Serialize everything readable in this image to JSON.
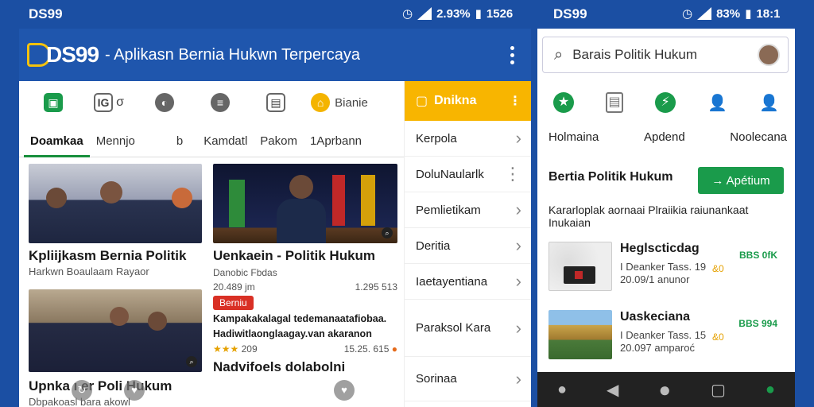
{
  "status": {
    "left_brand": "DS99",
    "right_brand": "DS99",
    "left_indicators": "2.93%",
    "left_time": "1526",
    "right_indicators": "83%",
    "right_time": "18:1"
  },
  "appbar": {
    "logo": "DS99",
    "title": "- Aplikasn Bernia Hukwn Terpercaya"
  },
  "iconrow": {
    "items": [
      {
        "icon": "briefcase-icon",
        "color": "#1a9b4b",
        "label": ""
      },
      {
        "icon": "photo-icon",
        "color": "#666666",
        "label": "IG"
      },
      {
        "icon": "globe-icon",
        "color": "#666666",
        "label": ""
      },
      {
        "icon": "chat-icon",
        "color": "#666666",
        "label": ""
      },
      {
        "icon": "document-icon",
        "color": "#666666",
        "label": ""
      },
      {
        "icon": "shield-icon",
        "color": "#f4b400",
        "label": "Bianie"
      }
    ]
  },
  "tabs": {
    "items": [
      "Doamkaa",
      "Mennjo",
      "b",
      "Kamdatl",
      "Pakom",
      "1Aprbann"
    ]
  },
  "cards": [
    {
      "title": "Kpliijkasm Bernia Politik",
      "subtitle": "Harkwn Boaulaam Rayaor"
    },
    {
      "title": "Uenkaein - Politik Hukum",
      "subtitle": "Danobic Fbdas",
      "meta_left": "20.489 jm",
      "meta_right": "1.295 513"
    },
    {
      "title": "Upnka ı  er Poli  Hukum",
      "subtitle": "Dbpakoasl bara akowl"
    },
    {
      "badge": "Berniu",
      "desc_line1": "Kampakakalagal tedemanaatafiobaa.",
      "desc_line2": "Hadiwitlaonglaagay.van akaranon",
      "rating": "★★★",
      "rating_count": "209",
      "meta_right": "15.25. 615"
    },
    {
      "title": "Nadvifoels dolabolni"
    }
  ],
  "menu": {
    "header": "Dnikna",
    "items": [
      "Kerpola",
      "DoluNaularlk",
      "Pemlietikam",
      "Deritia",
      "Iaetayentiana",
      "Paraksol Kara",
      "Sorinaa"
    ]
  },
  "right": {
    "search_text": "Barais Politik Hukum",
    "tabs": [
      "Holmaina",
      "Apdend",
      "Noolecana"
    ],
    "section_title": "Bertia Politik Hukum",
    "action_button": "→ Apétium",
    "description": "Kararloplak aornaai Plraiikia raiunankaat Inukaian",
    "list": [
      {
        "title": "Heglscticdag",
        "sub_line1": "I Deanker Tass. 19",
        "sub_line2": "20.09/1 anunor",
        "flag": "&0",
        "price": "BBS 0fK"
      },
      {
        "title": "Uaskeciana",
        "sub_line1": "I Deanker Tass. 15",
        "sub_line2": "20.097 amparoć",
        "flag": "&0",
        "price": "BBS 994"
      }
    ]
  },
  "navbar": [
    "person-icon",
    "back-icon",
    "home-icon",
    "recents-icon",
    "profile-icon"
  ]
}
